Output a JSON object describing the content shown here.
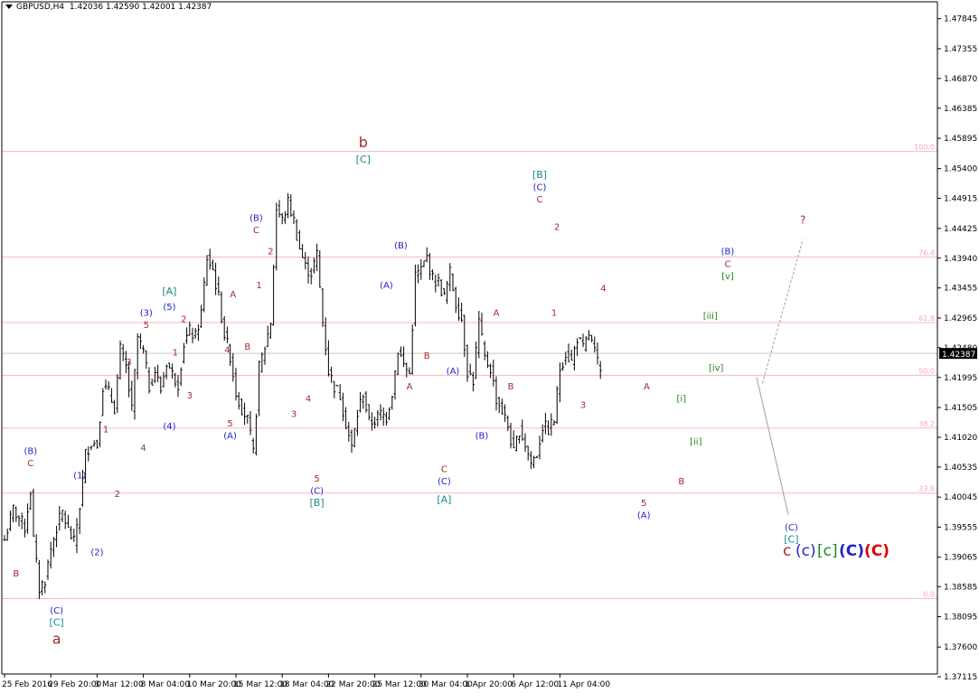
{
  "header": {
    "symbol": "GBPUSD,H4",
    "ohlc": "1.42036 1.42590 1.42001 1.42387"
  },
  "colors": {
    "candle": "#000000",
    "fib_line": "#f2b8c6",
    "fib_label": "#f0a8b8",
    "axis": "#000000",
    "price_marker_bg": "#000000",
    "price_marker_text": "#ffffff",
    "brown": "#a52a2a",
    "blue": "#2222cc",
    "teal": "#1a8a8a",
    "green": "#1a8a1a",
    "red": "#dd0000",
    "forecast": "#a0a0a0"
  },
  "chart_data": {
    "type": "candlestick",
    "symbol": "GBPUSD",
    "timeframe": "H4",
    "ylim": [
      1.3716,
      1.4812
    ],
    "y_ticks": [
      "1.47845",
      "1.47355",
      "1.46870",
      "1.46385",
      "1.45895",
      "1.45400",
      "1.44915",
      "1.44425",
      "1.43940",
      "1.43455",
      "1.42965",
      "1.42480",
      "1.41995",
      "1.41505",
      "1.41020",
      "1.40535",
      "1.40045",
      "1.39555",
      "1.39065",
      "1.38585",
      "1.38095",
      "1.37600",
      "1.37115"
    ],
    "x_ticks": [
      "25 Feb 2016",
      "29 Feb 20:00",
      "3 Mar 12:00",
      "8 Mar 04:00",
      "10 Mar 20:00",
      "15 Mar 12:00",
      "18 Mar 04:00",
      "22 Mar 20:00",
      "25 Mar 12:00",
      "30 Mar 04:00",
      "1 Apr 20:00",
      "6 Apr 12:00",
      "11 Apr 04:00"
    ],
    "x_tick_bar": [
      0,
      16,
      32,
      48,
      64,
      80,
      96,
      112,
      128,
      144,
      160,
      176,
      192
    ],
    "current_price": "1.42387",
    "fib_levels": [
      {
        "label": "100.0",
        "price": 1.4568
      },
      {
        "label": "76.4",
        "price": 1.4396
      },
      {
        "label": "61.8",
        "price": 1.4289
      },
      {
        "label": "50.0",
        "price": 1.4203
      },
      {
        "label": "38.2",
        "price": 1.4117
      },
      {
        "label": "23.6",
        "price": 1.4011
      },
      {
        "label": "0.0",
        "price": 1.3839
      }
    ],
    "close_path": [
      [
        0,
        1.3935
      ],
      [
        3,
        1.3985
      ],
      [
        7,
        1.3955
      ],
      [
        9,
        1.4015
      ],
      [
        10,
        1.3935
      ],
      [
        12,
        1.3855
      ],
      [
        14,
        1.387
      ],
      [
        16,
        1.392
      ],
      [
        18,
        1.3955
      ],
      [
        20,
        1.398
      ],
      [
        22,
        1.395
      ],
      [
        24,
        1.393
      ],
      [
        26,
        1.399
      ],
      [
        28,
        1.4075
      ],
      [
        30,
        1.4095
      ],
      [
        32,
        1.409
      ],
      [
        34,
        1.4185
      ],
      [
        36,
        1.4175
      ],
      [
        38,
        1.415
      ],
      [
        40,
        1.4245
      ],
      [
        42,
        1.4215
      ],
      [
        44,
        1.4145
      ],
      [
        46,
        1.4265
      ],
      [
        48,
        1.424
      ],
      [
        50,
        1.4185
      ],
      [
        52,
        1.421
      ],
      [
        54,
        1.418
      ],
      [
        56,
        1.4225
      ],
      [
        58,
        1.4205
      ],
      [
        60,
        1.419
      ],
      [
        62,
        1.4255
      ],
      [
        64,
        1.4275
      ],
      [
        66,
        1.4265
      ],
      [
        68,
        1.4305
      ],
      [
        70,
        1.4395
      ],
      [
        72,
        1.4375
      ],
      [
        74,
        1.433
      ],
      [
        76,
        1.427
      ],
      [
        78,
        1.4235
      ],
      [
        80,
        1.4175
      ],
      [
        82,
        1.415
      ],
      [
        84,
        1.413
      ],
      [
        86,
        1.4075
      ],
      [
        88,
        1.4215
      ],
      [
        90,
        1.425
      ],
      [
        92,
        1.429
      ],
      [
        94,
        1.4475
      ],
      [
        96,
        1.4455
      ],
      [
        98,
        1.4485
      ],
      [
        100,
        1.4455
      ],
      [
        102,
        1.441
      ],
      [
        104,
        1.438
      ],
      [
        106,
        1.437
      ],
      [
        108,
        1.44
      ],
      [
        110,
        1.429
      ],
      [
        112,
        1.421
      ],
      [
        114,
        1.4185
      ],
      [
        116,
        1.417
      ],
      [
        118,
        1.4125
      ],
      [
        120,
        1.4085
      ],
      [
        122,
        1.414
      ],
      [
        124,
        1.4175
      ],
      [
        126,
        1.4125
      ],
      [
        128,
        1.413
      ],
      [
        130,
        1.414
      ],
      [
        132,
        1.4135
      ],
      [
        134,
        1.4175
      ],
      [
        136,
        1.4245
      ],
      [
        138,
        1.422
      ],
      [
        140,
        1.4205
      ],
      [
        142,
        1.4365
      ],
      [
        144,
        1.4375
      ],
      [
        146,
        1.4395
      ],
      [
        148,
        1.436
      ],
      [
        150,
        1.4355
      ],
      [
        152,
        1.433
      ],
      [
        154,
        1.437
      ],
      [
        156,
        1.432
      ],
      [
        158,
        1.4295
      ],
      [
        160,
        1.421
      ],
      [
        162,
        1.4195
      ],
      [
        164,
        1.429
      ],
      [
        166,
        1.423
      ],
      [
        168,
        1.4215
      ],
      [
        170,
        1.4165
      ],
      [
        172,
        1.4145
      ],
      [
        174,
        1.412
      ],
      [
        176,
        1.4075
      ],
      [
        178,
        1.4115
      ],
      [
        180,
        1.409
      ],
      [
        182,
        1.406
      ],
      [
        184,
        1.4075
      ],
      [
        186,
        1.412
      ],
      [
        188,
        1.4115
      ],
      [
        190,
        1.413
      ],
      [
        192,
        1.4215
      ],
      [
        194,
        1.424
      ],
      [
        196,
        1.4225
      ],
      [
        198,
        1.4265
      ],
      [
        200,
        1.4245
      ],
      [
        202,
        1.427
      ],
      [
        204,
        1.424
      ],
      [
        206,
        1.4205
      ]
    ],
    "wave_labels": [
      {
        "text": "B",
        "bar": 4,
        "price": 1.3875,
        "color": "brown",
        "size": 10
      },
      {
        "text": "C",
        "bar": 9,
        "price": 1.4055,
        "color": "brown",
        "size": 10
      },
      {
        "text": "(B)",
        "bar": 9,
        "price": 1.4075,
        "color": "blue",
        "size": 10
      },
      {
        "text": "(C)",
        "bar": 18,
        "price": 1.3815,
        "color": "blue",
        "size": 10
      },
      {
        "text": "[C]",
        "bar": 18,
        "price": 1.3795,
        "color": "teal",
        "size": 11
      },
      {
        "text": "a",
        "bar": 18,
        "price": 1.3765,
        "color": "brown",
        "size": 16
      },
      {
        "text": "(1)",
        "bar": 26,
        "price": 1.4035,
        "color": "blue",
        "size": 10
      },
      {
        "text": "1",
        "bar": 35,
        "price": 1.411,
        "color": "brown",
        "size": 10
      },
      {
        "text": "(2)",
        "bar": 32,
        "price": 1.391,
        "color": "blue",
        "size": 10
      },
      {
        "text": "2",
        "bar": 39,
        "price": 1.4005,
        "color": "brown",
        "size": 10
      },
      {
        "text": "3",
        "bar": 43,
        "price": 1.422,
        "color": "brown",
        "size": 10
      },
      {
        "text": "4",
        "bar": 48,
        "price": 1.408,
        "color": "brown",
        "size": 10
      },
      {
        "text": "5",
        "bar": 49,
        "price": 1.428,
        "color": "brown",
        "size": 10
      },
      {
        "text": "(3)",
        "bar": 49,
        "price": 1.43,
        "color": "blue",
        "size": 10
      },
      {
        "text": "(4)",
        "bar": 57,
        "price": 1.4115,
        "color": "blue",
        "size": 10
      },
      {
        "text": "(5)",
        "bar": 57,
        "price": 1.431,
        "color": "blue",
        "size": 10
      },
      {
        "text": "[A]",
        "bar": 57,
        "price": 1.4335,
        "color": "teal",
        "size": 11
      },
      {
        "text": "2",
        "bar": 62,
        "price": 1.429,
        "color": "brown",
        "size": 10
      },
      {
        "text": "1",
        "bar": 59,
        "price": 1.4235,
        "color": "brown",
        "size": 10
      },
      {
        "text": "3",
        "bar": 64,
        "price": 1.4165,
        "color": "brown",
        "size": 10
      },
      {
        "text": "4",
        "bar": 77,
        "price": 1.424,
        "color": "brown",
        "size": 10
      },
      {
        "text": "5",
        "bar": 78,
        "price": 1.412,
        "color": "brown",
        "size": 10
      },
      {
        "text": "(A)",
        "bar": 78,
        "price": 1.41,
        "color": "blue",
        "size": 10
      },
      {
        "text": "A",
        "bar": 79,
        "price": 1.433,
        "color": "brown",
        "size": 10
      },
      {
        "text": "B",
        "bar": 84,
        "price": 1.4245,
        "color": "brown",
        "size": 10
      },
      {
        "text": "(B)",
        "bar": 87,
        "price": 1.4455,
        "color": "blue",
        "size": 10
      },
      {
        "text": "C",
        "bar": 87,
        "price": 1.4435,
        "color": "brown",
        "size": 10
      },
      {
        "text": "2",
        "bar": 92,
        "price": 1.44,
        "color": "brown",
        "size": 10
      },
      {
        "text": "1",
        "bar": 88,
        "price": 1.4345,
        "color": "brown",
        "size": 10
      },
      {
        "text": "3",
        "bar": 100,
        "price": 1.4135,
        "color": "brown",
        "size": 10
      },
      {
        "text": "4",
        "bar": 105,
        "price": 1.416,
        "color": "brown",
        "size": 10
      },
      {
        "text": "5",
        "bar": 108,
        "price": 1.403,
        "color": "brown",
        "size": 10
      },
      {
        "text": "(C)",
        "bar": 108,
        "price": 1.401,
        "color": "blue",
        "size": 10
      },
      {
        "text": "[B]",
        "bar": 108,
        "price": 1.399,
        "color": "teal",
        "size": 11
      },
      {
        "text": "b",
        "bar": 124,
        "price": 1.4575,
        "color": "brown",
        "size": 16
      },
      {
        "text": "[C]",
        "bar": 124,
        "price": 1.455,
        "color": "teal",
        "size": 11
      },
      {
        "text": "(B)",
        "bar": 137,
        "price": 1.441,
        "color": "blue",
        "size": 10
      },
      {
        "text": "(A)",
        "bar": 132,
        "price": 1.4345,
        "color": "blue",
        "size": 10
      },
      {
        "text": "A",
        "bar": 140,
        "price": 1.418,
        "color": "brown",
        "size": 10
      },
      {
        "text": "B",
        "bar": 146,
        "price": 1.423,
        "color": "brown",
        "size": 10
      },
      {
        "text": "(A)",
        "bar": 155,
        "price": 1.4205,
        "color": "blue",
        "size": 10
      },
      {
        "text": "(B)",
        "bar": 165,
        "price": 1.41,
        "color": "blue",
        "size": 10
      },
      {
        "text": "C",
        "bar": 152,
        "price": 1.4045,
        "color": "brown",
        "size": 10
      },
      {
        "text": "(C)",
        "bar": 152,
        "price": 1.4025,
        "color": "blue",
        "size": 10
      },
      {
        "text": "[A]",
        "bar": 152,
        "price": 1.3995,
        "color": "teal",
        "size": 11
      },
      {
        "text": "A",
        "bar": 170,
        "price": 1.43,
        "color": "brown",
        "size": 10
      },
      {
        "text": "B",
        "bar": 175,
        "price": 1.418,
        "color": "brown",
        "size": 10
      },
      {
        "text": "[B]",
        "bar": 185,
        "price": 1.4525,
        "color": "teal",
        "size": 11
      },
      {
        "text": "(C)",
        "bar": 185,
        "price": 1.4505,
        "color": "blue",
        "size": 10
      },
      {
        "text": "C",
        "bar": 185,
        "price": 1.4485,
        "color": "brown",
        "size": 10
      },
      {
        "text": "2",
        "bar": 191,
        "price": 1.444,
        "color": "brown",
        "size": 10
      },
      {
        "text": "1",
        "bar": 190,
        "price": 1.43,
        "color": "brown",
        "size": 10
      },
      {
        "text": "3",
        "bar": 200,
        "price": 1.415,
        "color": "brown",
        "size": 10
      },
      {
        "text": "4",
        "bar": 207,
        "price": 1.434,
        "color": "brown",
        "size": 10
      },
      {
        "text": "A",
        "bar": 222,
        "price": 1.418,
        "color": "brown",
        "size": 10
      },
      {
        "text": "5",
        "bar": 221,
        "price": 1.399,
        "color": "brown",
        "size": 10
      },
      {
        "text": "(A)",
        "bar": 221,
        "price": 1.397,
        "color": "blue",
        "size": 10
      },
      {
        "text": "[i]",
        "bar": 234,
        "price": 1.416,
        "color": "green",
        "size": 10
      },
      {
        "text": "B",
        "bar": 234,
        "price": 1.4025,
        "color": "brown",
        "size": 10
      },
      {
        "text": "[ii]",
        "bar": 239,
        "price": 1.409,
        "color": "green",
        "size": 10
      },
      {
        "text": "[iii]",
        "bar": 244,
        "price": 1.4295,
        "color": "green",
        "size": 10
      },
      {
        "text": "[iv]",
        "bar": 246,
        "price": 1.421,
        "color": "green",
        "size": 10
      },
      {
        "text": "[v]",
        "bar": 250,
        "price": 1.436,
        "color": "green",
        "size": 10
      },
      {
        "text": "C",
        "bar": 250,
        "price": 1.438,
        "color": "brown",
        "size": 10
      },
      {
        "text": "(B)",
        "bar": 250,
        "price": 1.44,
        "color": "blue",
        "size": 10
      },
      {
        "text": "?",
        "bar": 276,
        "price": 1.445,
        "color": "brown",
        "size": 12
      },
      {
        "text": "(C)",
        "bar": 272,
        "price": 1.395,
        "color": "blue",
        "size": 10
      },
      {
        "text": "[C]",
        "bar": 272,
        "price": 1.393,
        "color": "teal",
        "size": 11
      }
    ],
    "big_labels": [
      {
        "text": "c",
        "color": "brown"
      },
      {
        "text": "(c)",
        "color": "blue"
      },
      {
        "text": "[c]",
        "color": "green"
      },
      {
        "text": "(C)",
        "color": "blue"
      },
      {
        "text": "(C)",
        "color": "red"
      }
    ]
  }
}
